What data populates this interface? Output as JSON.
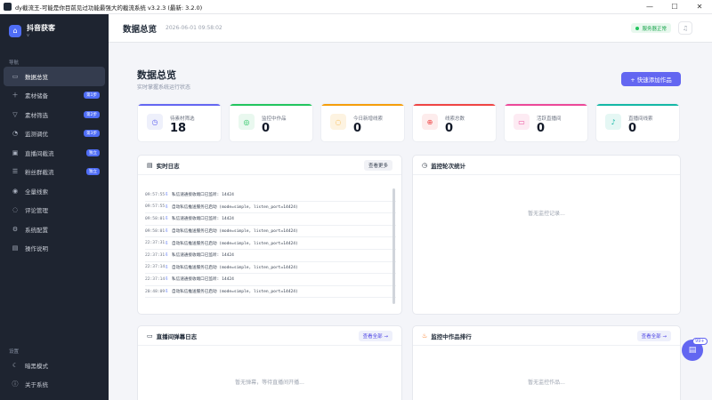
{
  "window": {
    "title": "dy截流王-可能是你目前见过功能最强大的截流系统 v3.2.3 (最新: 3.2.0)"
  },
  "sidebar": {
    "brand_name": "抖音获客",
    "brand_sub": "v",
    "nav_section": "导航",
    "items": [
      {
        "label": "数据总览",
        "icon": "dashboard-icon",
        "badge": "",
        "active": true
      },
      {
        "label": "素材储备",
        "icon": "plus-icon",
        "badge": "第1步"
      },
      {
        "label": "素材筛选",
        "icon": "filter-icon",
        "badge": "第2步"
      },
      {
        "label": "监测调优",
        "icon": "tune-icon",
        "badge": "第3步"
      },
      {
        "label": "直播间截流",
        "icon": "live-icon",
        "badge": "独立"
      },
      {
        "label": "粉丝群截流",
        "icon": "group-icon",
        "badge": "独立"
      },
      {
        "label": "全量线索",
        "icon": "leads-icon",
        "badge": ""
      },
      {
        "label": "评论管理",
        "icon": "comment-icon",
        "badge": ""
      },
      {
        "label": "系统配置",
        "icon": "settings-icon",
        "badge": ""
      },
      {
        "label": "操作说明",
        "icon": "book-icon",
        "badge": ""
      }
    ],
    "settings_section": "设置",
    "bottom_items": [
      {
        "label": "暗黑模式",
        "icon": "moon-icon"
      },
      {
        "label": "关于系统",
        "icon": "info-icon"
      }
    ]
  },
  "header": {
    "title": "数据总览",
    "timestamp": "2026-06-01 09:58:02",
    "status": "服务器正常"
  },
  "main": {
    "title": "数据总览",
    "subtitle": "实时掌握系统运行状态",
    "add_button": "+ 快速添加作品"
  },
  "stats": [
    {
      "label": "待素材筛选",
      "value": "18",
      "color": "#6366f1",
      "bg": "#eef0fb",
      "icon": "clock-icon"
    },
    {
      "label": "监控中作品",
      "value": "0",
      "color": "#22c55e",
      "bg": "#e9f8ef",
      "icon": "activity-icon"
    },
    {
      "label": "今日新增线索",
      "value": "0",
      "color": "#f59e0b",
      "bg": "#fdf3e1",
      "icon": "chat-icon"
    },
    {
      "label": "线索总数",
      "value": "0",
      "color": "#ef4444",
      "bg": "#fdecec",
      "icon": "target-icon"
    },
    {
      "label": "活跃直播间",
      "value": "0",
      "color": "#ec4899",
      "bg": "#fdebf3",
      "icon": "video-icon"
    },
    {
      "label": "直播间线索",
      "value": "0",
      "color": "#14b8a6",
      "bg": "#e5f7f4",
      "icon": "mic-icon"
    }
  ],
  "log_panel": {
    "title": "实时日志",
    "button": "查看更多",
    "rows": [
      {
        "time": "09:57:55",
        "text": "私信速通接收端口已监听: 14424"
      },
      {
        "time": "09:57:55",
        "text": "自动私信推送服务已启动 (mode=simple, listen_port=14424)"
      },
      {
        "time": "09:58:01",
        "text": "私信速通接收端口已监听: 14424"
      },
      {
        "time": "09:58:01",
        "text": "自动私信推送服务已启动 (mode=simple, listen_port=14424)"
      },
      {
        "time": "22:37:31",
        "text": "自动私信推送服务已启动 (mode=simple, listen_port=14424)"
      },
      {
        "time": "22:37:31",
        "text": "私信速通接收端口已监听: 14424"
      },
      {
        "time": "22:37:14",
        "text": "自动私信推送服务已启动 (mode=simple, listen_port=14424)"
      },
      {
        "time": "22:37:14",
        "text": "私信速通接收端口已监听: 14424"
      },
      {
        "time": "20:48:09",
        "text": "自动私信推送服务已启动 (mode=simple, listen_port=14424)"
      }
    ]
  },
  "monitor_panel": {
    "title": "监控轮次统计",
    "empty": "暂无监控记录..."
  },
  "danmaku_panel": {
    "title": "直播间弹幕日志",
    "button": "查看全部 →",
    "empty": "暂无弹幕，等待直播间开播..."
  },
  "rank_panel": {
    "title": "监控中作品排行",
    "button": "查看全部 →",
    "empty": "暂无监控作品..."
  },
  "float": {
    "badge": "99+"
  }
}
